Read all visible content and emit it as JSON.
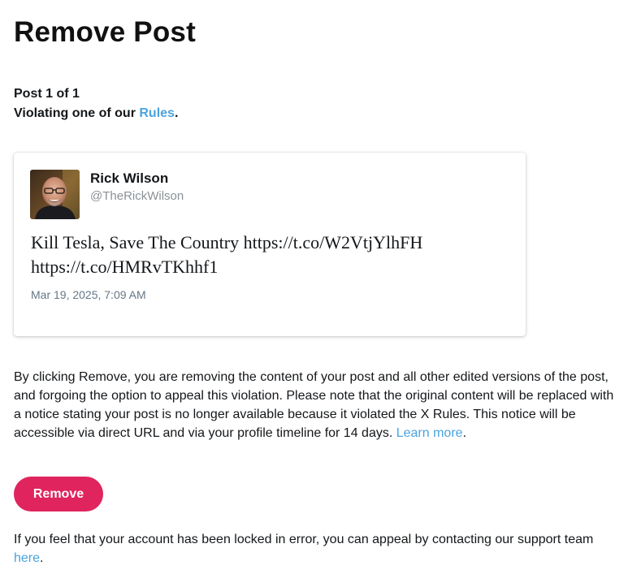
{
  "page": {
    "title": "Remove Post",
    "post_count": "Post 1 of 1",
    "violation_prefix": "Violating one of our ",
    "rules_link": "Rules",
    "violation_suffix": "."
  },
  "tweet": {
    "author_name": "Rick Wilson",
    "author_handle": "@TheRickWilson",
    "text": "Kill Tesla, Save The Country https://t.co/W2VtjYlhFH https://t.co/HMRvTKhhf1",
    "timestamp": "Mar 19, 2025, 7:09 AM"
  },
  "disclaimer": {
    "text": "By clicking Remove, you are removing the content of your post and all other edited versions of the post, and forgoing the option to appeal this violation. Please note that the original content will be replaced with a notice stating your post is no longer available because it violated the X Rules. This notice will be accessible via direct URL and via your profile timeline for 14 days. ",
    "learn_more": "Learn more",
    "suffix": "."
  },
  "actions": {
    "remove_label": "Remove"
  },
  "appeal": {
    "text": "If you feel that your account has been locked in error, you can appeal by contacting our support team ",
    "here_link": "here",
    "suffix": "."
  },
  "colors": {
    "link": "#4aa3df",
    "remove_button": "#e0245e"
  },
  "icons": {
    "avatar": "avatar-photo"
  }
}
